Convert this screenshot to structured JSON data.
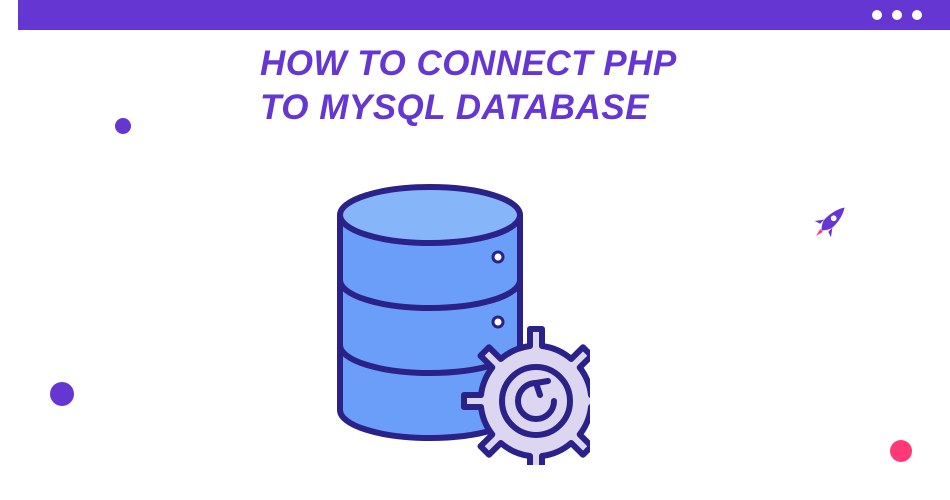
{
  "header": {
    "dots": 3
  },
  "title": {
    "line1": "HOW TO CONNECT PHP",
    "line2": "TO MYSQL DATABASE"
  },
  "colors": {
    "primary": "#6536D1",
    "accent": "#FF3978",
    "db_fill": "#6B9EF8",
    "db_stroke": "#2A2288",
    "gear_fill": "#DDD6F1"
  },
  "icons": {
    "rocket": "rocket-icon",
    "database": "database-icon",
    "gear": "gear-refresh-icon"
  }
}
